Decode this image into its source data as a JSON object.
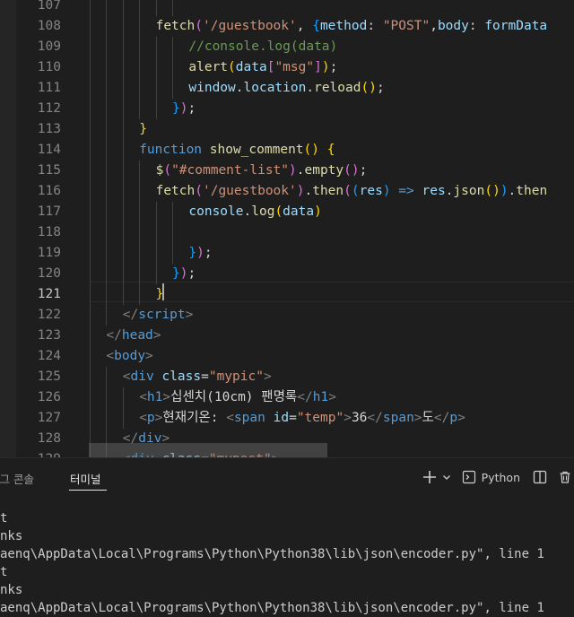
{
  "editor": {
    "lines": [
      {
        "num": "107",
        "segs": []
      },
      {
        "num": "108",
        "segs": [
          [
            "fn",
            "fetch"
          ],
          [
            "b2",
            "("
          ],
          [
            "str",
            "'/guestbook'"
          ],
          [
            "pun",
            ", "
          ],
          [
            "b3",
            "{"
          ],
          [
            "prop",
            "method"
          ],
          [
            "pun",
            ": "
          ],
          [
            "str",
            "\"POST\""
          ],
          [
            "pun",
            ","
          ],
          [
            "prop",
            "body"
          ],
          [
            "pun",
            ": "
          ],
          [
            "prop",
            "formData"
          ]
        ]
      },
      {
        "num": "109",
        "segs": [
          [
            "cm",
            "//console.log(data)"
          ]
        ]
      },
      {
        "num": "110",
        "segs": [
          [
            "fn",
            "alert"
          ],
          [
            "b1",
            "("
          ],
          [
            "prop",
            "data"
          ],
          [
            "b2",
            "["
          ],
          [
            "str",
            "\"msg\""
          ],
          [
            "b2",
            "]"
          ],
          [
            "b1",
            ")"
          ],
          [
            "pun",
            ";"
          ]
        ]
      },
      {
        "num": "111",
        "segs": [
          [
            "prop",
            "window"
          ],
          [
            "pun",
            "."
          ],
          [
            "prop",
            "location"
          ],
          [
            "pun",
            "."
          ],
          [
            "fn",
            "reload"
          ],
          [
            "b1",
            "()"
          ],
          [
            "pun",
            ";"
          ]
        ]
      },
      {
        "num": "112",
        "segs": [
          [
            "b3",
            "}"
          ],
          [
            "b2",
            ")"
          ],
          [
            "pun",
            ";"
          ]
        ]
      },
      {
        "num": "113",
        "segs": [
          [
            "b1",
            "}"
          ]
        ]
      },
      {
        "num": "114",
        "segs": [
          [
            "kw",
            "function "
          ],
          [
            "fn",
            "show_comment"
          ],
          [
            "b1",
            "()"
          ],
          [
            "pun",
            " "
          ],
          [
            "b1",
            "{"
          ]
        ]
      },
      {
        "num": "115",
        "segs": [
          [
            "fn",
            "$"
          ],
          [
            "b2",
            "("
          ],
          [
            "str",
            "\"#comment-list\""
          ],
          [
            "b2",
            ")"
          ],
          [
            "pun",
            "."
          ],
          [
            "fn",
            "empty"
          ],
          [
            "b2",
            "()"
          ],
          [
            "pun",
            ";"
          ]
        ]
      },
      {
        "num": "116",
        "segs": [
          [
            "fn",
            "fetch"
          ],
          [
            "b2",
            "("
          ],
          [
            "str",
            "'/guestbook'"
          ],
          [
            "b2",
            ")"
          ],
          [
            "pun",
            "."
          ],
          [
            "fn",
            "then"
          ],
          [
            "b2",
            "("
          ],
          [
            "b3",
            "("
          ],
          [
            "prop",
            "res"
          ],
          [
            "b3",
            ")"
          ],
          [
            "pun",
            " "
          ],
          [
            "kw",
            "=>"
          ],
          [
            "pun",
            " "
          ],
          [
            "prop",
            "res"
          ],
          [
            "pun",
            "."
          ],
          [
            "fn",
            "json"
          ],
          [
            "b1",
            "()"
          ],
          [
            "b3",
            ")"
          ],
          [
            "pun",
            "."
          ],
          [
            "fn",
            "then"
          ]
        ]
      },
      {
        "num": "117",
        "segs": [
          [
            "prop",
            "console"
          ],
          [
            "pun",
            "."
          ],
          [
            "fn",
            "log"
          ],
          [
            "b1",
            "("
          ],
          [
            "prop",
            "data"
          ],
          [
            "b1",
            ")"
          ]
        ]
      },
      {
        "num": "118",
        "segs": []
      },
      {
        "num": "119",
        "segs": [
          [
            "b3",
            "}"
          ],
          [
            "b2",
            ")"
          ],
          [
            "pun",
            ";"
          ]
        ]
      },
      {
        "num": "120",
        "segs": [
          [
            "b3",
            "}"
          ],
          [
            "b2",
            ")"
          ],
          [
            "pun",
            ";"
          ]
        ]
      },
      {
        "num": "121",
        "segs": [
          [
            "b1",
            "}"
          ]
        ]
      },
      {
        "num": "122",
        "segs": [
          [
            "ang",
            "</"
          ],
          [
            "tag",
            "script"
          ],
          [
            "ang",
            ">"
          ]
        ]
      },
      {
        "num": "123",
        "segs": [
          [
            "ang",
            "</"
          ],
          [
            "tag",
            "head"
          ],
          [
            "ang",
            ">"
          ]
        ]
      },
      {
        "num": "124",
        "segs": [
          [
            "ang",
            "<"
          ],
          [
            "tag",
            "body"
          ],
          [
            "ang",
            ">"
          ]
        ]
      },
      {
        "num": "125",
        "segs": [
          [
            "ang",
            "<"
          ],
          [
            "tag",
            "div"
          ],
          [
            "pun",
            " "
          ],
          [
            "attr",
            "class"
          ],
          [
            "pun",
            "="
          ],
          [
            "str",
            "\"mypic\""
          ],
          [
            "ang",
            ">"
          ]
        ]
      },
      {
        "num": "126",
        "segs": [
          [
            "ang",
            "<"
          ],
          [
            "tag",
            "h1"
          ],
          [
            "ang",
            ">"
          ],
          [
            "txt",
            "십센치(10cm) 팬명록"
          ],
          [
            "ang",
            "</"
          ],
          [
            "tag",
            "h1"
          ],
          [
            "ang",
            ">"
          ]
        ]
      },
      {
        "num": "127",
        "segs": [
          [
            "ang",
            "<"
          ],
          [
            "tag",
            "p"
          ],
          [
            "ang",
            ">"
          ],
          [
            "txt",
            "현재기온: "
          ],
          [
            "ang",
            "<"
          ],
          [
            "tag",
            "span"
          ],
          [
            "pun",
            " "
          ],
          [
            "attr",
            "id"
          ],
          [
            "pun",
            "="
          ],
          [
            "str",
            "\"temp\""
          ],
          [
            "ang",
            ">"
          ],
          [
            "txt",
            "36"
          ],
          [
            "ang",
            "</"
          ],
          [
            "tag",
            "span"
          ],
          [
            "ang",
            ">"
          ],
          [
            "txt",
            "도"
          ],
          [
            "ang",
            "</"
          ],
          [
            "tag",
            "p"
          ],
          [
            "ang",
            ">"
          ]
        ]
      },
      {
        "num": "128",
        "segs": [
          [
            "ang",
            "</"
          ],
          [
            "tag",
            "div"
          ],
          [
            "ang",
            ">"
          ]
        ]
      },
      {
        "num": "129",
        "segs": [
          [
            "ang",
            "<"
          ],
          [
            "tag",
            "div"
          ],
          [
            "pun",
            " "
          ],
          [
            "attr",
            "class"
          ],
          [
            "pun",
            "="
          ],
          [
            "str",
            "\"mypost\""
          ],
          [
            "ang",
            ">"
          ]
        ]
      }
    ]
  },
  "panel": {
    "tabs": [
      "버그 콘솔",
      "터미널"
    ],
    "active_tab": "터미널",
    "add_icon": "plus-icon",
    "dropdown_icon": "chevron-down-icon",
    "shell_icon": "terminal-icon",
    "shell_name": "Python",
    "split_icon": "split-icon",
    "trash_icon": "trash-icon"
  },
  "terminal": {
    "lines": [
      "t",
      "nks",
      "aenq\\AppData\\Local\\Programs\\Python\\Python38\\lib\\json\\encoder.py\", line 1",
      "t",
      "nks",
      "aenq\\AppData\\Local\\Programs\\Python\\Python38\\lib\\json\\encoder.py\", line 1"
    ]
  }
}
